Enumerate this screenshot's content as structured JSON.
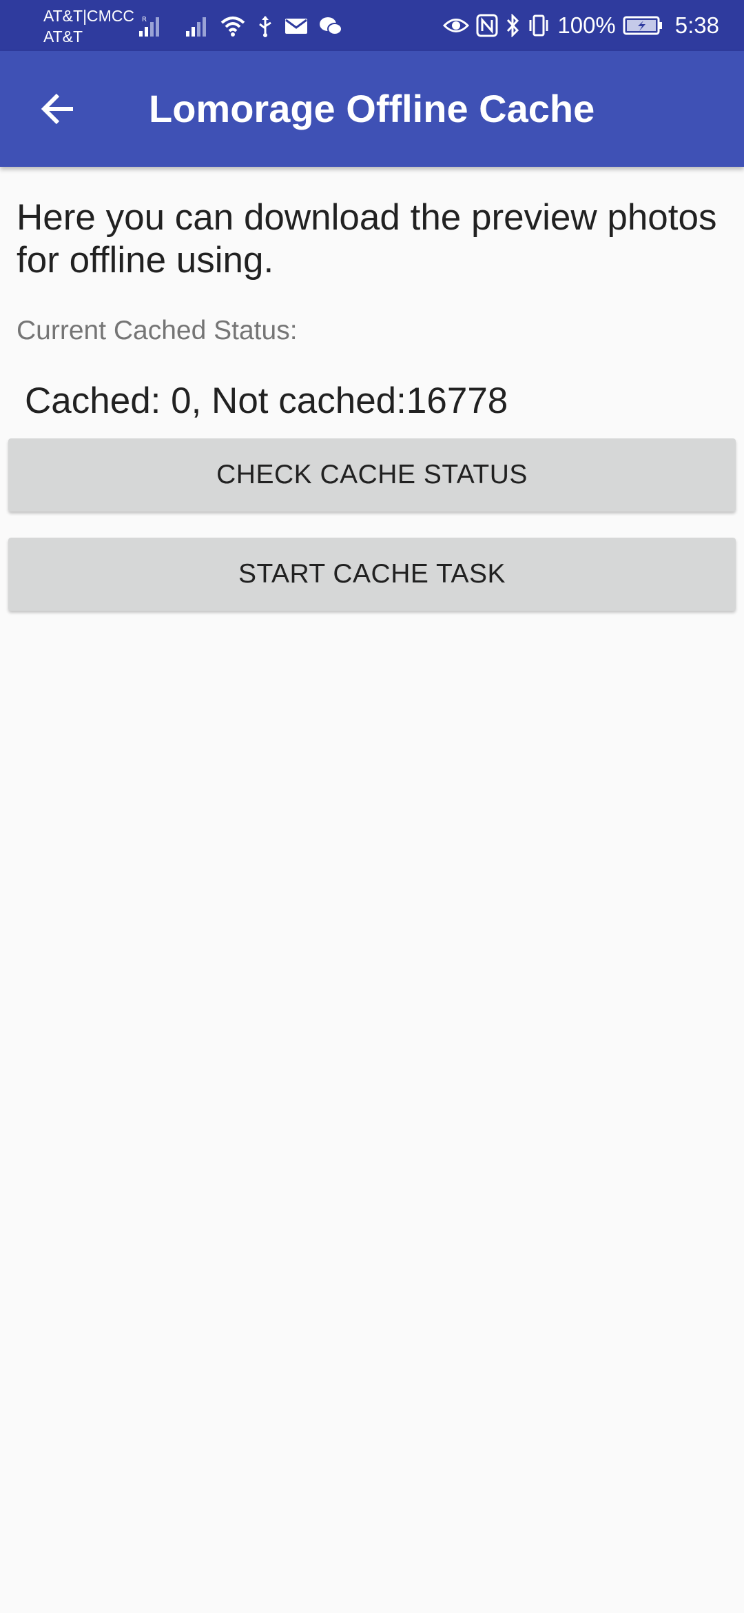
{
  "status_bar": {
    "carrier_line1": "AT&T|CMCC",
    "carrier_line2": "AT&T",
    "battery": "100%",
    "time": "5:38",
    "icons": [
      "signal-icon",
      "signal-icon",
      "wifi-icon",
      "usb-icon",
      "mail-icon",
      "wechat-icon",
      "eye-icon",
      "nfc-icon",
      "bluetooth-icon",
      "vibrate-icon",
      "battery-icon"
    ]
  },
  "app_bar": {
    "title": "Lomorage Offline Cache",
    "back_icon": "arrow-back-icon",
    "background": "#3f51b5"
  },
  "content": {
    "intro": "Here you can download the preview photos for offline using.",
    "status_label": "Current Cached Status:",
    "status_value": "Cached: 0, Not cached:16778"
  },
  "buttons": {
    "check_label": "CHECK CACHE STATUS",
    "start_label": "START CACHE TASK"
  }
}
